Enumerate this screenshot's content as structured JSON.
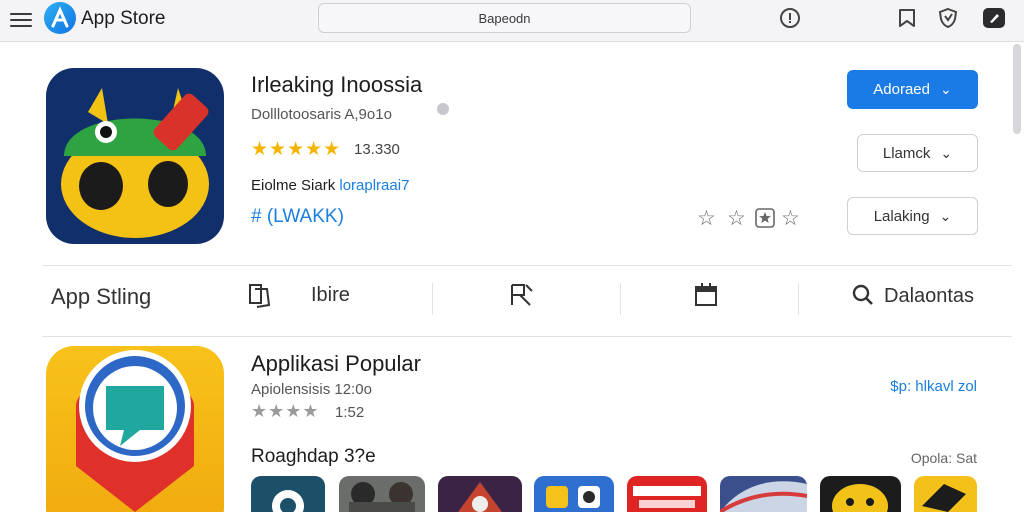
{
  "topbar": {
    "app_name": "App Store",
    "search_placeholder": "Bapeodn",
    "icons": [
      "menu-icon",
      "info-icon",
      "bookmark-icon",
      "shield-icon",
      "edit-icon"
    ]
  },
  "hero": {
    "title": "Irleaking Inoossia",
    "developer": "Dolllotoosaris A,9o1o",
    "rating_count": "13.330",
    "meta_label": "Eiolme Siark",
    "meta_link": "loraplraai7",
    "tag_link": "# (LWAKK)",
    "primary_button": "Adoraed",
    "secondary_button_1": "Llamck",
    "secondary_button_2": "Lalaking"
  },
  "tabs": {
    "heading": "App Stling",
    "items": [
      {
        "label": "",
        "icon": "copy-icon"
      },
      {
        "label": "Ibire",
        "icon": ""
      },
      {
        "label": "",
        "icon": "compass-icon"
      },
      {
        "label": "",
        "icon": "calendar-icon"
      },
      {
        "label": "Dalaontas",
        "icon": "search-icon"
      }
    ]
  },
  "popular": {
    "title": "Applikasi Popular",
    "subtitle": "Apiolensisis 12:0o",
    "rating_count": "1:52",
    "see_all": "$p: hlkavl zol",
    "row_heading": "Roaghdap 3?e",
    "row_link": "Opola: Sat"
  },
  "colors": {
    "accent": "#1a7be6",
    "link": "#1a7fe0",
    "star": "#f5b400"
  }
}
